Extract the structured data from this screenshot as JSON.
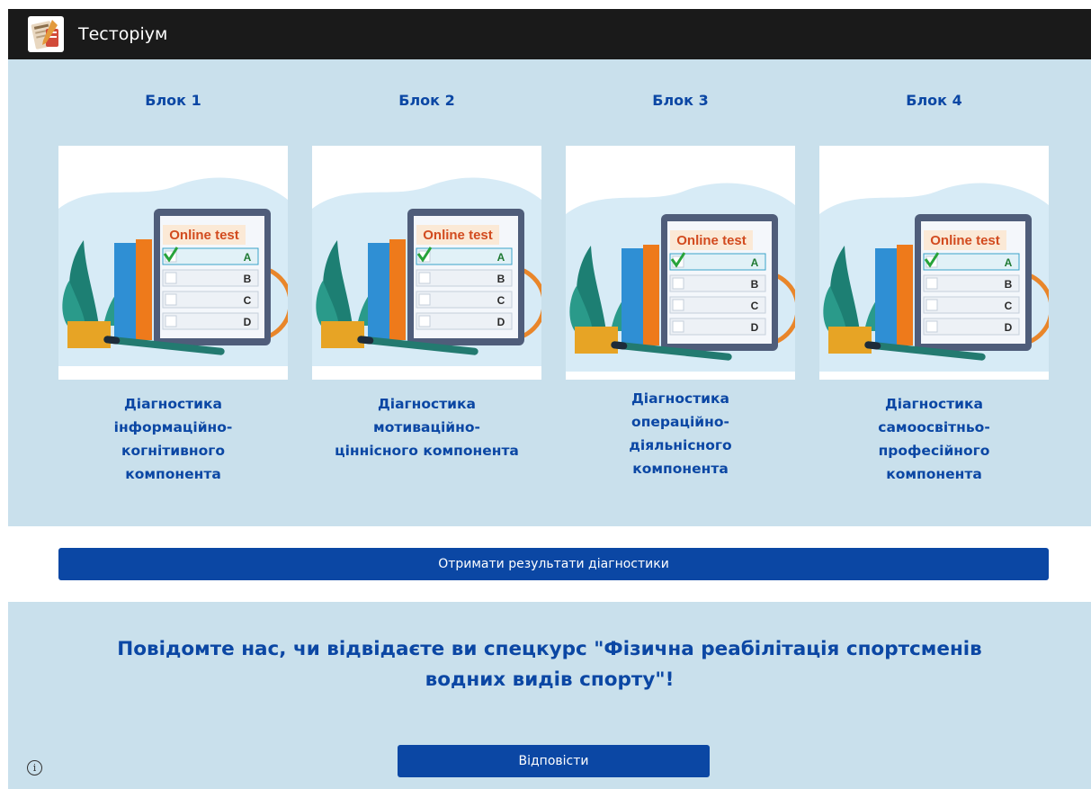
{
  "navbar": {
    "title": "Тесторіум",
    "logo_icon": "test-clipboard-logo-icon"
  },
  "blocks": [
    {
      "heading": "Блок 1",
      "image_text": "Online test",
      "options": [
        "A",
        "B",
        "C",
        "D"
      ],
      "caption": "Діагностика\nінформаційно-\nкогнітивного\nкомпонента"
    },
    {
      "heading": "Блок 2",
      "image_text": "Online test",
      "options": [
        "A",
        "B",
        "C",
        "D"
      ],
      "caption": "Діагностика\nмотиваційно-\nціннісного компонента"
    },
    {
      "heading": "Блок 3",
      "image_text": "Online test",
      "options": [
        "A",
        "B",
        "C",
        "D"
      ],
      "caption": "Діагностика\nопераційно-\nдіяльнісного\nкомпонента"
    },
    {
      "heading": "Блок 4",
      "image_text": "Online test",
      "options": [
        "A",
        "B",
        "C",
        "D"
      ],
      "caption": "Діагностика\nсамоосвітньо-\nпрофесійного\nкомпонента"
    }
  ],
  "results_button": {
    "label": "Отримати результати діагностики"
  },
  "survey": {
    "text": "Повідомте нас, чи відвідаєте ви спецкурс \"Фізична реабілітація спортсменів\nводних видів спорту\"!",
    "answer_label": "Відповісти"
  },
  "info_button": {
    "symbol": "i",
    "icon": "info-icon"
  },
  "colors": {
    "accent": "#0b47a4",
    "section_bg": "#c9e0ec",
    "navbar_bg": "#1a1a1a"
  }
}
